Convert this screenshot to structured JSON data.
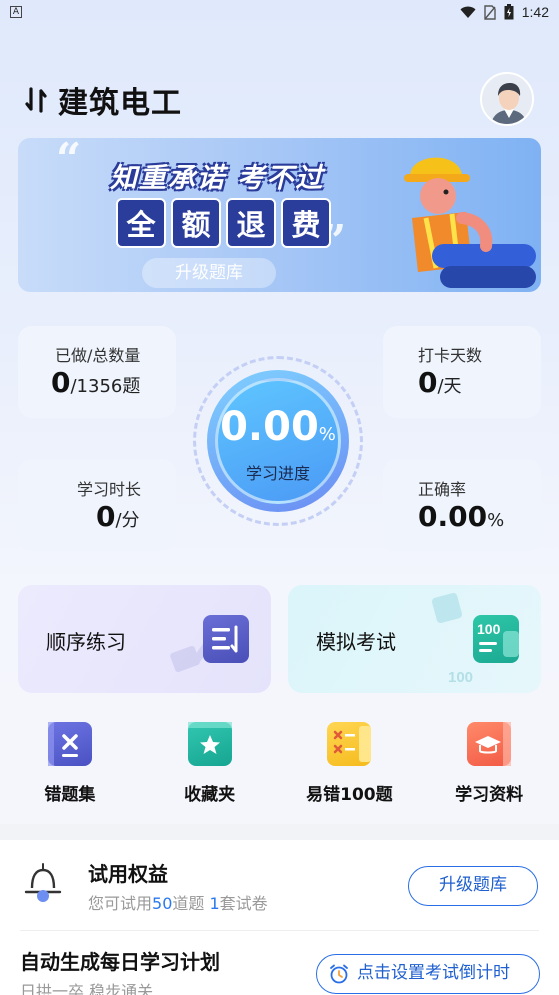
{
  "status_bar": {
    "time": "1:42",
    "app_badge": "A"
  },
  "header": {
    "title": "建筑电工"
  },
  "banner": {
    "line1": "知重承诺 考不过",
    "line2_chars": [
      "全",
      "额",
      "退",
      "费"
    ],
    "button": "升级题库"
  },
  "stats": {
    "done_label": "已做/总数量",
    "done_value": "0",
    "done_unit": "/1356题",
    "checkin_label": "打卡天数",
    "checkin_value": "0",
    "checkin_unit": "/天",
    "duration_label": "学习时长",
    "duration_value": "0",
    "duration_unit": "/分",
    "accuracy_label": "正确率",
    "accuracy_value": "0.00",
    "accuracy_unit": "%",
    "progress_value": "0.00",
    "progress_unit": "%",
    "progress_label": "学习进度"
  },
  "practice": {
    "sequential": "顺序练习",
    "mock_exam": "模拟考试",
    "mock_icon_text": "100"
  },
  "quick": [
    {
      "label": "错题集",
      "icon": "wrong-book-icon"
    },
    {
      "label": "收藏夹",
      "icon": "favorites-icon"
    },
    {
      "label": "易错100题",
      "icon": "error-prone-icon"
    },
    {
      "label": "学习资料",
      "icon": "study-material-icon"
    }
  ],
  "trial": {
    "title": "试用权益",
    "sub_prefix": "您可试用",
    "questions": "50",
    "sub_mid": "道题 ",
    "papers": "1",
    "sub_suffix": "套试卷",
    "button": "升级题库"
  },
  "plan": {
    "title": "自动生成每日学习计划",
    "sub": "日拱一卒 稳步通关",
    "button": "点击设置考试倒计时"
  },
  "colors": {
    "accent": "#2a6fe6",
    "highlight": "#2a79f0"
  }
}
